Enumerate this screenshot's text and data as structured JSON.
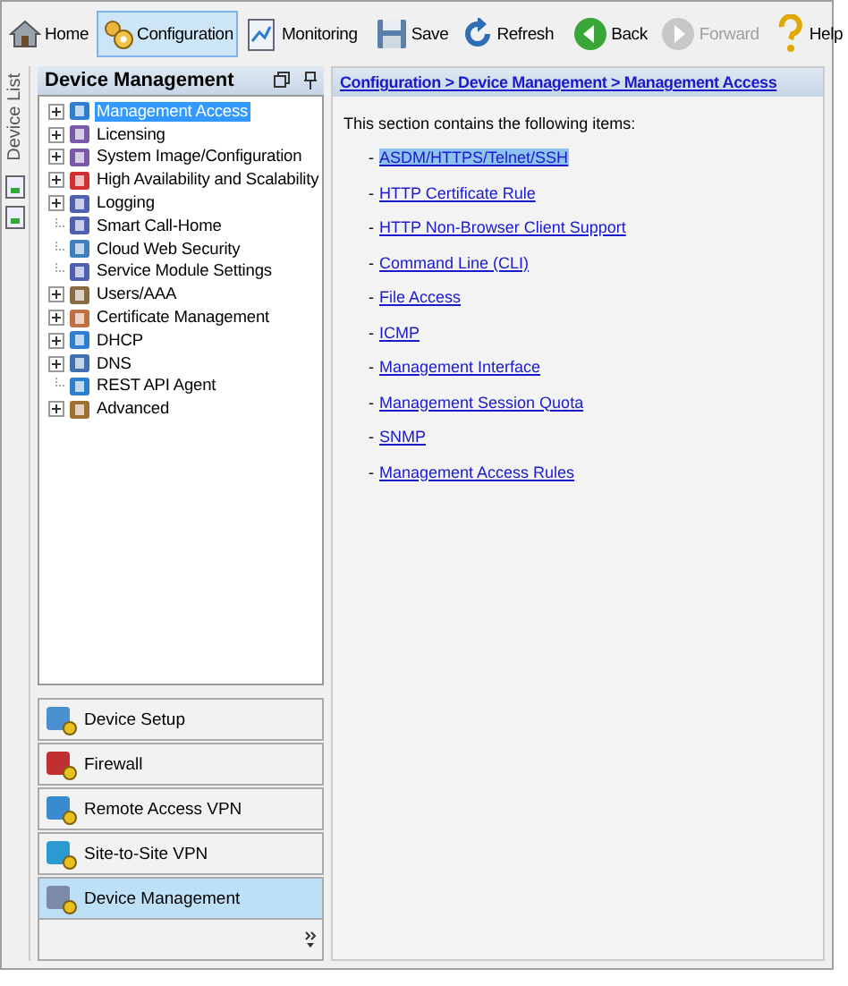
{
  "toolbar": [
    {
      "kind": "home",
      "label": "Home",
      "selected": false,
      "disabled": false
    },
    {
      "kind": "config",
      "label": "Configuration",
      "selected": true,
      "disabled": false
    },
    {
      "kind": "monitor",
      "label": "Monitoring",
      "selected": false,
      "disabled": false
    },
    {
      "kind": "save",
      "label": "Save",
      "selected": false,
      "disabled": false
    },
    {
      "kind": "refresh",
      "label": "Refresh",
      "selected": false,
      "disabled": false
    },
    {
      "kind": "back",
      "label": "Back",
      "selected": false,
      "disabled": false
    },
    {
      "kind": "forward",
      "label": "Forward",
      "selected": false,
      "disabled": true
    },
    {
      "kind": "help",
      "label": "Help",
      "selected": false,
      "disabled": false
    }
  ],
  "side_strip": {
    "label": "Device List"
  },
  "left_panel": {
    "title": "Device Management",
    "tree": [
      {
        "label": "Management Access",
        "expandable": true,
        "selected": true
      },
      {
        "label": "Licensing",
        "expandable": true,
        "selected": false
      },
      {
        "label": "System Image/Configuration",
        "expandable": true,
        "selected": false
      },
      {
        "label": "High Availability and Scalability",
        "expandable": true,
        "selected": false
      },
      {
        "label": "Logging",
        "expandable": true,
        "selected": false
      },
      {
        "label": "Smart Call-Home",
        "expandable": false,
        "selected": false
      },
      {
        "label": "Cloud Web Security",
        "expandable": false,
        "selected": false
      },
      {
        "label": "Service Module Settings",
        "expandable": false,
        "selected": false
      },
      {
        "label": "Users/AAA",
        "expandable": true,
        "selected": false
      },
      {
        "label": "Certificate Management",
        "expandable": true,
        "selected": false
      },
      {
        "label": "DHCP",
        "expandable": true,
        "selected": false
      },
      {
        "label": "DNS",
        "expandable": true,
        "selected": false
      },
      {
        "label": "REST API Agent",
        "expandable": false,
        "selected": false
      },
      {
        "label": "Advanced",
        "expandable": true,
        "selected": false
      }
    ],
    "nav_buttons": [
      {
        "label": "Device Setup",
        "selected": false
      },
      {
        "label": "Firewall",
        "selected": false
      },
      {
        "label": "Remote Access VPN",
        "selected": false
      },
      {
        "label": "Site-to-Site VPN",
        "selected": false
      },
      {
        "label": "Device Management",
        "selected": true
      }
    ]
  },
  "content": {
    "breadcrumb": "Configuration > Device Management > Management Access",
    "intro": "This section contains the following items:",
    "items": [
      {
        "marker": "-",
        "label": "ASDM/HTTPS/Telnet/SSH",
        "selected": true
      },
      {
        "marker": "-",
        "label": "HTTP Certificate Rule",
        "selected": false
      },
      {
        "marker": "-",
        "label": "HTTP Non-Browser Client Support",
        "selected": false
      },
      {
        "marker": "-",
        "label": "Command Line (CLI)",
        "selected": false
      },
      {
        "marker": "-",
        "label": "File Access",
        "selected": false
      },
      {
        "marker": "-",
        "label": "ICMP",
        "selected": false
      },
      {
        "marker": "-",
        "label": "Management Interface",
        "selected": false
      },
      {
        "marker": "-",
        "label": "Management Session Quota",
        "selected": false
      },
      {
        "marker": "-",
        "label": "SNMP",
        "selected": false
      },
      {
        "marker": "-",
        "label": "Management Access Rules",
        "selected": false
      }
    ]
  }
}
